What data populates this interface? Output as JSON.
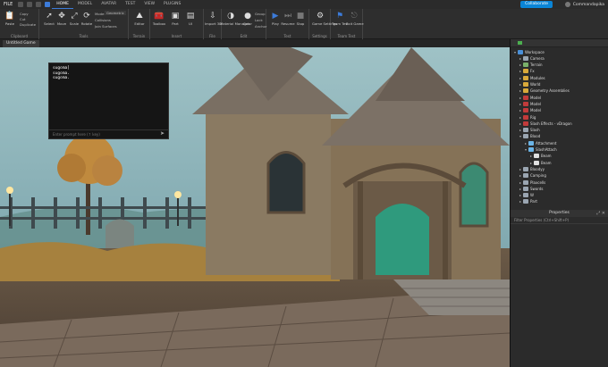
{
  "titlebar": {
    "file_label": "FILE",
    "menu_tabs": [
      "HOME",
      "MODEL",
      "AVATAR",
      "TEST",
      "VIEW",
      "PLUGINS"
    ],
    "active_tab": "HOME",
    "collaborate_label": "Collaborate",
    "user_name": "Commandapika"
  },
  "ribbon": {
    "clipboard": {
      "paste": "Paste",
      "copy": "Copy",
      "cut": "Cut",
      "duplicate": "Duplicate",
      "label": "Clipboard"
    },
    "tools": {
      "select": "Select",
      "move": "Move",
      "scale": "Scale",
      "rotate": "Rotate",
      "mode_label": "Mode:",
      "mode_value": "Geometric",
      "collisions": "Collisions",
      "join_surfaces": "Join Surfaces",
      "label": "Tools"
    },
    "terrain": {
      "editor": "Editor",
      "label": "Terrain"
    },
    "insert": {
      "toolbox": "Toolbox",
      "part": "Part",
      "ui": "UI",
      "label": "Insert"
    },
    "file": {
      "import_3d": "Import 3D",
      "label": "File"
    },
    "edit": {
      "material_manager": "Material Manager",
      "color": "Color",
      "group": "Group",
      "lock": "Lock",
      "anchor": "Anchor",
      "label": "Edit"
    },
    "test": {
      "play": "Play",
      "resume": "Resume",
      "stop": "Stop",
      "label": "Test"
    },
    "settings": {
      "game_settings": "Game Settings",
      "label": "Settings"
    },
    "team_test": {
      "team_test": "Team Test",
      "exit_game": "Exit Game",
      "label": "Team Test"
    }
  },
  "document_tab": "Untitled Game",
  "console": {
    "lines": [
      "sugoma]",
      "sugoma.",
      "sugoma."
    ],
    "input_placeholder": "Enter prompt here (↑ key)"
  },
  "explorer": {
    "items": [
      {
        "label": "Workspace",
        "indent": 0,
        "expanded": true,
        "icon": "workspace-icon"
      },
      {
        "label": "Camera",
        "indent": 1,
        "icon": "camera-icon"
      },
      {
        "label": "Terrain",
        "indent": 1,
        "icon": "terrain-icon"
      },
      {
        "label": "Fx",
        "indent": 1,
        "icon": "folder-icon"
      },
      {
        "label": "Modules",
        "indent": 1,
        "icon": "folder-icon"
      },
      {
        "label": "World",
        "indent": 1,
        "icon": "folder-icon"
      },
      {
        "label": "Geometry Assemblies",
        "indent": 1,
        "icon": "folder-icon"
      },
      {
        "label": "Model",
        "indent": 1,
        "icon": "model-icon"
      },
      {
        "label": "Model",
        "indent": 1,
        "icon": "model-icon"
      },
      {
        "label": "Model",
        "indent": 1,
        "icon": "model-icon"
      },
      {
        "label": "Rig",
        "indent": 1,
        "icon": "model-icon"
      },
      {
        "label": "Slash Effects - vDragon",
        "indent": 1,
        "icon": "model-icon"
      },
      {
        "label": "Slash",
        "indent": 1,
        "icon": "part-icon"
      },
      {
        "label": "Blood",
        "indent": 1,
        "expanded": true,
        "icon": "part-icon"
      },
      {
        "label": "Attachment",
        "indent": 2,
        "icon": "attachment-icon"
      },
      {
        "label": "SlashAttach",
        "indent": 2,
        "expanded": true,
        "icon": "attachment-icon"
      },
      {
        "label": "Beam",
        "indent": 3,
        "icon": "beam-icon"
      },
      {
        "label": "Beam",
        "indent": 3,
        "icon": "beam-icon"
      },
      {
        "label": "Bloodyy",
        "indent": 1,
        "icon": "part-icon"
      },
      {
        "label": "Camping",
        "indent": 1,
        "icon": "part-icon"
      },
      {
        "label": "Plaxcells",
        "indent": 1,
        "icon": "part-icon"
      },
      {
        "label": "Swords",
        "indent": 1,
        "icon": "part-icon"
      },
      {
        "label": "W",
        "indent": 1,
        "icon": "part-icon"
      },
      {
        "label": "Part",
        "indent": 1,
        "icon": "part-icon"
      }
    ]
  },
  "properties": {
    "title": "Properties",
    "filter_placeholder": "Filter Properties (Ctrl+Shift+P)"
  },
  "colors": {
    "accent": "#3c7bd9",
    "collaborate": "#0a84d6",
    "folder": "#d9a93a",
    "model": "#c23b3b"
  }
}
